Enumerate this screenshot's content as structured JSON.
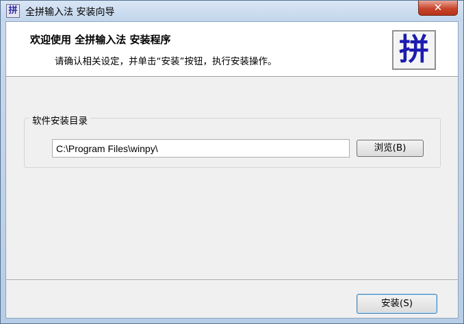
{
  "window": {
    "title": "全拼输入法 安装向导",
    "icon_glyph": "拼",
    "close_glyph": "✕"
  },
  "header": {
    "title": "欢迎使用 全拼输入法 安装程序",
    "subtitle": "请确认相关设定，并单击“安装”按钮，执行安装操作。",
    "logo_glyph": "拼"
  },
  "install_dir": {
    "group_label": "软件安装目录",
    "path_value": "C:\\Program Files\\winpy\\",
    "browse_label": "浏览(B)"
  },
  "footer": {
    "install_label": "安装(S)"
  },
  "icons": {
    "title_icon": "pinyin-app-icon",
    "close_icon": "close-icon",
    "logo": "pinyin-logo-icon"
  }
}
